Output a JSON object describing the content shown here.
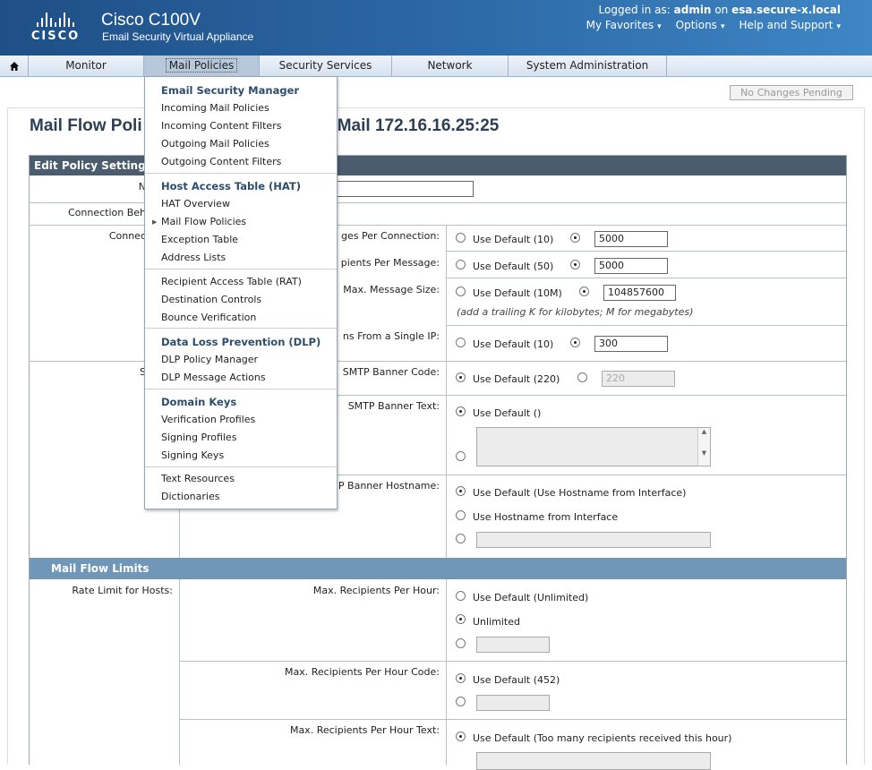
{
  "header": {
    "logo_text": "CISCO",
    "product_title": "Cisco C100V",
    "product_subtitle": "Email Security Virtual Appliance",
    "logged_in_prefix": "Logged in as:",
    "user": "admin",
    "on_text": "on",
    "host": "esa.secure-x.local",
    "links": [
      "My Favorites",
      "Options",
      "Help and Support"
    ]
  },
  "nav": {
    "items": [
      "Monitor",
      "Mail Policies",
      "Security Services",
      "Network",
      "System Administration"
    ],
    "active": "Mail Policies"
  },
  "pending_button": "No Changes Pending",
  "page_title_left": "Mail Flow Poli",
  "page_title_right": "ningMail 172.16.16.25:25",
  "table": {
    "header": "Edit Policy Settings",
    "labels_left": [
      "N",
      "Connection Beh",
      "Connec",
      "S"
    ],
    "connection": [
      {
        "label": "ges Per Connection:",
        "default": "Use Default (10)",
        "value": "5000"
      },
      {
        "label": "pients Per Message:",
        "default": "Use Default (50)",
        "value": "5000"
      },
      {
        "label": "Max. Message Size:",
        "default": "Use Default (10M)",
        "value": "104857600",
        "hint": "(add a trailing K for kilobytes; M for megabytes)"
      },
      {
        "label": "ns From a Single IP:",
        "default": "Use Default (10)",
        "value": "300"
      }
    ],
    "smtp": [
      {
        "label": "SMTP Banner Code:",
        "default": "Use Default (220)",
        "value": "220"
      },
      {
        "label": "SMTP Banner Text:",
        "default": "Use Default ()"
      },
      {
        "label": "P Banner Hostname:",
        "default": "Use Default (Use Hostname from Interface)",
        "option2": "Use Hostname from Interface"
      }
    ],
    "limits_section": "Mail Flow Limits",
    "rate_limit_label": "Rate Limit for Hosts:",
    "limits": [
      {
        "label": "Max. Recipients Per Hour:",
        "default": "Use Default (Unlimited)",
        "option2": "Unlimited"
      },
      {
        "label": "Max. Recipients Per Hour Code:",
        "default": "Use Default (452)"
      },
      {
        "label": "Max. Recipients Per Hour Text:",
        "default": "Use Default (Too many recipients received this hour)"
      }
    ]
  },
  "dropdown": {
    "groups": [
      {
        "head": "Email Security Manager",
        "items": [
          "Incoming Mail Policies",
          "Incoming Content Filters",
          "Outgoing Mail Policies",
          "Outgoing Content Filters"
        ]
      },
      {
        "head": "Host Access Table (HAT)",
        "items": [
          "HAT Overview",
          "Mail Flow Policies",
          "Exception Table",
          "Address Lists"
        ]
      },
      {
        "head": "",
        "items": [
          "Recipient Access Table (RAT)",
          "Destination Controls",
          "Bounce Verification"
        ]
      },
      {
        "head": "Data Loss Prevention (DLP)",
        "items": [
          "DLP Policy Manager",
          "DLP Message Actions"
        ]
      },
      {
        "head": "Domain Keys",
        "items": [
          "Verification Profiles",
          "Signing Profiles",
          "Signing Keys"
        ]
      },
      {
        "head": "",
        "items": [
          "Text Resources",
          "Dictionaries"
        ]
      }
    ],
    "current_item": "Mail Flow Policies"
  }
}
